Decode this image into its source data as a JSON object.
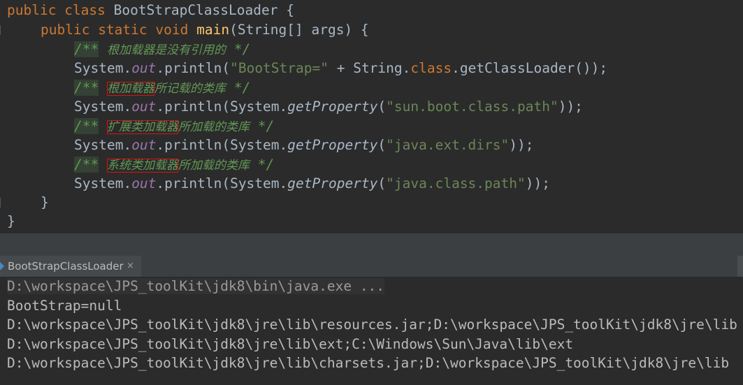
{
  "editor": {
    "line1": {
      "kw1": "public",
      "kw2": "class",
      "class_name": "BootStrapClassLoader",
      "brace": "{"
    },
    "line2": {
      "kw1": "public",
      "kw2": "static",
      "kw3": "void",
      "method": "main",
      "params": "(String[] args) {"
    },
    "comment1": {
      "open": "/**",
      "text": "根加载器是没有引用的",
      "close": "*/"
    },
    "stmt1": {
      "pre": "System.",
      "field": "out",
      "mid": ".println(",
      "str": "\"BootStrap=\"",
      "plus": " + String.",
      "kwclass": "class",
      "post": ".getClassLoader());"
    },
    "comment2": {
      "open": "/**",
      "boxed": "根加载器",
      "rest": "所记载的类库",
      "close": "*/"
    },
    "stmt2": {
      "pre": "System.",
      "field": "out",
      "mid": ".println(System.",
      "call": "getProperty",
      "paren": "(",
      "str": "\"sun.boot.class.path\"",
      "post": "));"
    },
    "comment3": {
      "open": "/**",
      "boxed": "扩展类加载器",
      "rest": "所加载的类库",
      "close": "*/"
    },
    "stmt3": {
      "pre": "System.",
      "field": "out",
      "mid": ".println(System.",
      "call": "getProperty",
      "paren": "(",
      "str": "\"java.ext.dirs\"",
      "post": "));"
    },
    "comment4": {
      "open": "/**",
      "boxed": "系统类加载器",
      "rest": "所加载的类库",
      "close": "*/"
    },
    "stmt4": {
      "pre": "System.",
      "field": "out",
      "mid": ".println(System.",
      "call": "getProperty",
      "paren": "(",
      "str": "\"java.class.path\"",
      "post": "));"
    },
    "close_method": "}",
    "close_class": "}"
  },
  "run_panel": {
    "tab_label": "BootStrapClassLoader",
    "tab_close": "×",
    "tab_icon": "run-config-icon"
  },
  "console": {
    "command": "D:\\workspace\\JPS_toolKit\\jdk8\\bin\\java.exe ...",
    "lines": [
      "BootStrap=null",
      "D:\\workspace\\JPS_toolKit\\jdk8\\jre\\lib\\resources.jar;D:\\workspace\\JPS_toolKit\\jdk8\\jre\\lib",
      "D:\\workspace\\JPS_toolKit\\jdk8\\jre\\lib\\ext;C:\\Windows\\Sun\\Java\\lib\\ext",
      "D:\\workspace\\JPS_toolKit\\jdk8\\jre\\lib\\charsets.jar;D:\\workspace\\JPS_toolKit\\jdk8\\jre\\lib"
    ]
  },
  "colors": {
    "background": "#2b2b2b",
    "keyword": "#cc7832",
    "method": "#ffc66d",
    "string": "#6a8759",
    "field": "#9876aa",
    "comment": "#629755",
    "highlight_box": "#dd1111"
  }
}
